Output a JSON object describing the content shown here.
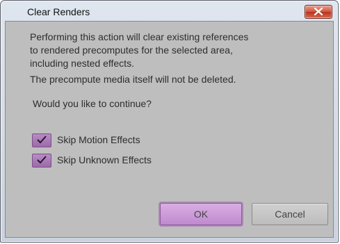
{
  "dialog": {
    "title": "Clear Renders",
    "close_label": "close"
  },
  "message": {
    "line1": "Performing this action will clear existing references",
    "line2": "to rendered precomputes for the selected area,",
    "line3": "including nested effects.",
    "line4": "The precompute media itself will not be deleted.",
    "question": "Would you like to continue?"
  },
  "options": [
    {
      "label": "Skip Motion Effects",
      "checked": true
    },
    {
      "label": "Skip Unknown Effects",
      "checked": true
    }
  ],
  "buttons": {
    "ok": "OK",
    "cancel": "Cancel"
  },
  "colors": {
    "accent": "#c08acf",
    "panel": "#bebebe",
    "close": "#d0553d"
  }
}
